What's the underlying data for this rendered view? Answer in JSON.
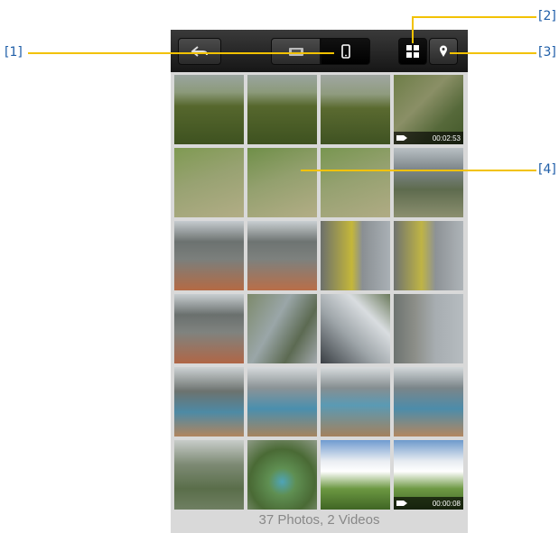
{
  "footer": {
    "summary": "37 Photos, 2 Videos"
  },
  "videos": [
    {
      "duration": "00:02:53"
    },
    {
      "duration": "00:00:08"
    }
  ],
  "callouts": [
    "[1]",
    "[2]",
    "[3]",
    "[4]"
  ],
  "colors": {
    "callout_text": "#1f5ea8",
    "callout_line": "#f2c200",
    "toolbar": "#1e1e1e"
  },
  "icons": {
    "back": "back-arrow-icon",
    "camera_view": "camera-view-icon",
    "phone_view": "phone-view-icon",
    "grid": "grid-icon",
    "map": "map-pin-icon"
  }
}
